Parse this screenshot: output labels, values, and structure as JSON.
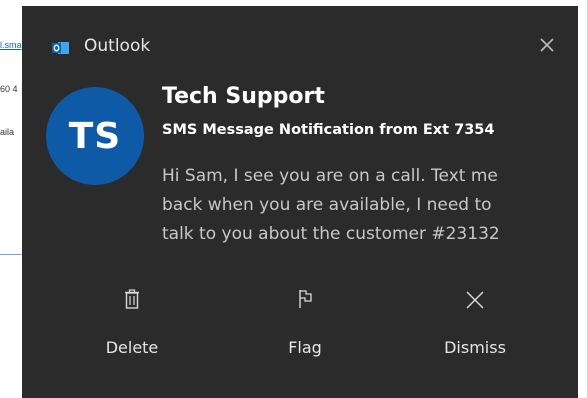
{
  "background": {
    "link_fragment": "l.sma",
    "line1_fragment": "60 4",
    "line2_fragment": "aila"
  },
  "toast": {
    "app_name": "Outlook",
    "app_icon": "outlook-icon",
    "close_icon": "close-icon",
    "avatar_initials": "TS",
    "avatar_color": "#0f5aa6",
    "sender": "Tech Support",
    "subject": "SMS Message Notification from Ext 7354",
    "message_lines": [
      "Hi Sam, I see you are on a call. Text me",
      "back when you are available, I need to",
      "talk to you about the customer #23132"
    ],
    "actions": {
      "delete": {
        "label": "Delete",
        "icon": "trash-icon"
      },
      "flag": {
        "label": "Flag",
        "icon": "flag-icon"
      },
      "dismiss": {
        "label": "Dismiss",
        "icon": "close-icon"
      }
    },
    "background_color": "#2b2b2b"
  }
}
